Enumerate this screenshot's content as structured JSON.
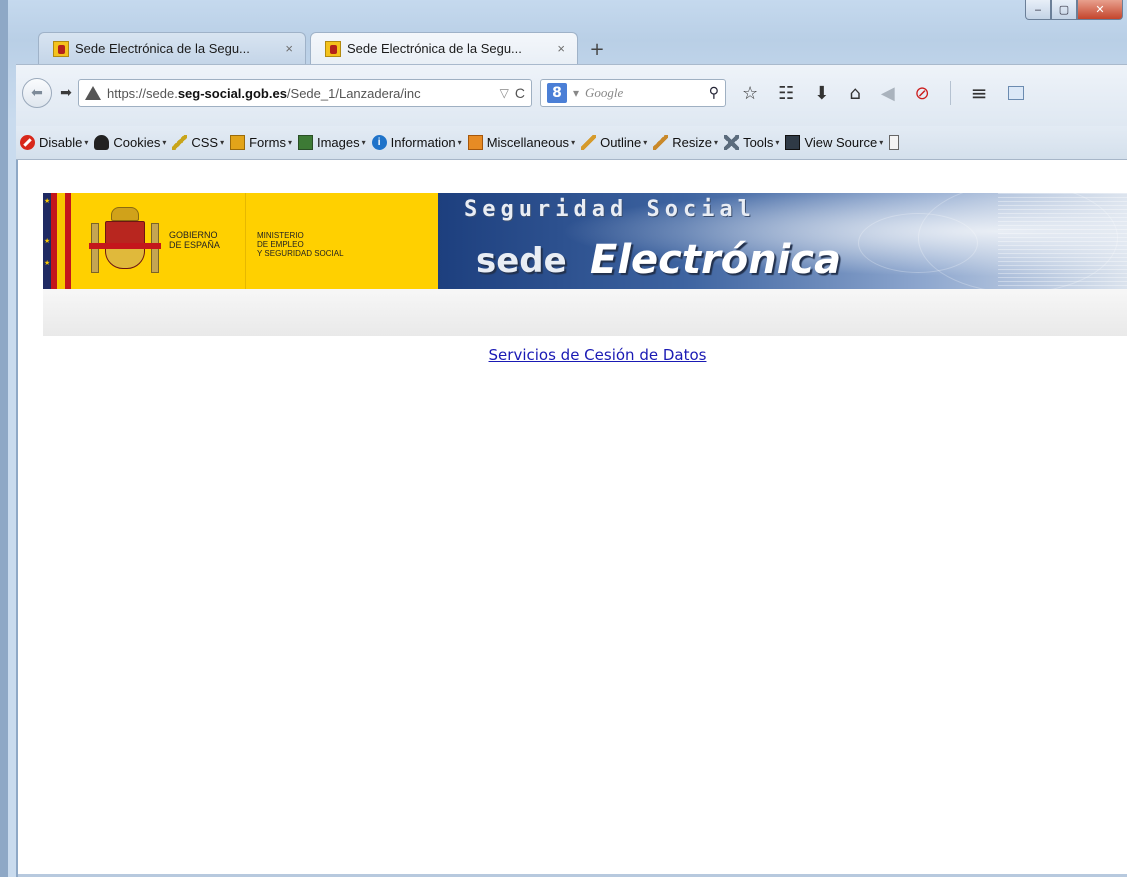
{
  "window": {
    "minimize_glyph": "‒",
    "maximize_glyph": "▢",
    "close_glyph": "✕"
  },
  "tabs": [
    {
      "title": "Sede Electrónica de la Segu...",
      "close": "×",
      "active": false
    },
    {
      "title": "Sede Electrónica de la Segu...",
      "close": "×",
      "active": true
    }
  ],
  "new_tab_glyph": "+",
  "navbar": {
    "url_prefix": "https://sede.",
    "url_domain": "seg-social.gob.es",
    "url_path": "/Sede_1/Lanzadera/inc",
    "url_dropdown": "▽",
    "reload_glyph": "C",
    "search_engine_label": "8",
    "search_dropdown": "▾",
    "search_placeholder": "Google",
    "search_glyph": "⚲"
  },
  "devbar": {
    "items": [
      {
        "label": "Disable",
        "icon": "disable-icon"
      },
      {
        "label": "Cookies",
        "icon": "cookies-icon"
      },
      {
        "label": "CSS",
        "icon": "css-icon"
      },
      {
        "label": "Forms",
        "icon": "forms-icon"
      },
      {
        "label": "Images",
        "icon": "images-icon"
      },
      {
        "label": "Information",
        "icon": "information-icon"
      },
      {
        "label": "Miscellaneous",
        "icon": "miscellaneous-icon"
      },
      {
        "label": "Outline",
        "icon": "outline-icon"
      },
      {
        "label": "Resize",
        "icon": "resize-icon"
      },
      {
        "label": "Tools",
        "icon": "tools-icon"
      },
      {
        "label": "View Source",
        "icon": "view-source-icon"
      }
    ],
    "caret": "▾"
  },
  "banner": {
    "gov_line1": "GOBIERNO",
    "gov_line2": "DE ESPAÑA",
    "ministry_line1": "MINISTERIO",
    "ministry_line2": "DE EMPLEO",
    "ministry_line3": "Y SEGURIDAD SOCIAL",
    "hero_title": "Seguridad Social",
    "hero_sede": "sede",
    "hero_electronica": "Electrónica"
  },
  "page": {
    "link_text": "Servicios de Cesión de Datos"
  },
  "colors": {
    "link": "#1a1ab4",
    "gov_yellow": "#ffd000",
    "hero_blue": "#1d3f7e"
  }
}
